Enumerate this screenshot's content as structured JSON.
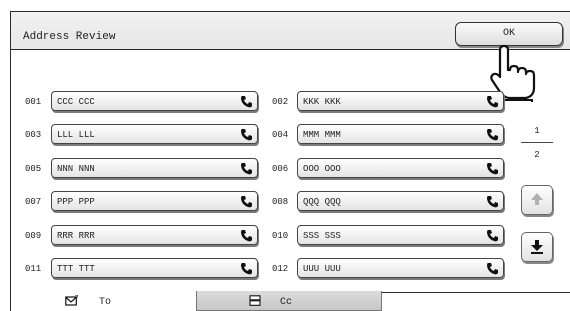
{
  "header": {
    "title": "Address Review",
    "ok_label": "OK"
  },
  "entries": [
    {
      "num": "001",
      "label": "CCC CCC"
    },
    {
      "num": "002",
      "label": "KKK KKK"
    },
    {
      "num": "003",
      "label": "LLL LLL"
    },
    {
      "num": "004",
      "label": "MMM MMM"
    },
    {
      "num": "005",
      "label": "NNN NNN"
    },
    {
      "num": "006",
      "label": "OOO OOO"
    },
    {
      "num": "007",
      "label": "PPP PPP"
    },
    {
      "num": "008",
      "label": "QQQ QQQ"
    },
    {
      "num": "009",
      "label": "RRR RRR"
    },
    {
      "num": "010",
      "label": "SSS SSS"
    },
    {
      "num": "011",
      "label": "TTT TTT"
    },
    {
      "num": "012",
      "label": "UUU UUU"
    }
  ],
  "entry_icon": "phone-icon",
  "pager": {
    "current": "1",
    "total": "2",
    "up_icon": "arrow-up-icon",
    "down_icon": "arrow-down-end-icon"
  },
  "tabs": [
    {
      "label": "To",
      "icon": "envelope-icon"
    },
    {
      "label": "Cc",
      "icon": "stacked-mail-icon"
    }
  ],
  "colors": {
    "border": "#2a2a2a",
    "button_top": "#ffffff",
    "button_bottom": "#e4e4e4",
    "active_tab": "#c7c7c7"
  }
}
